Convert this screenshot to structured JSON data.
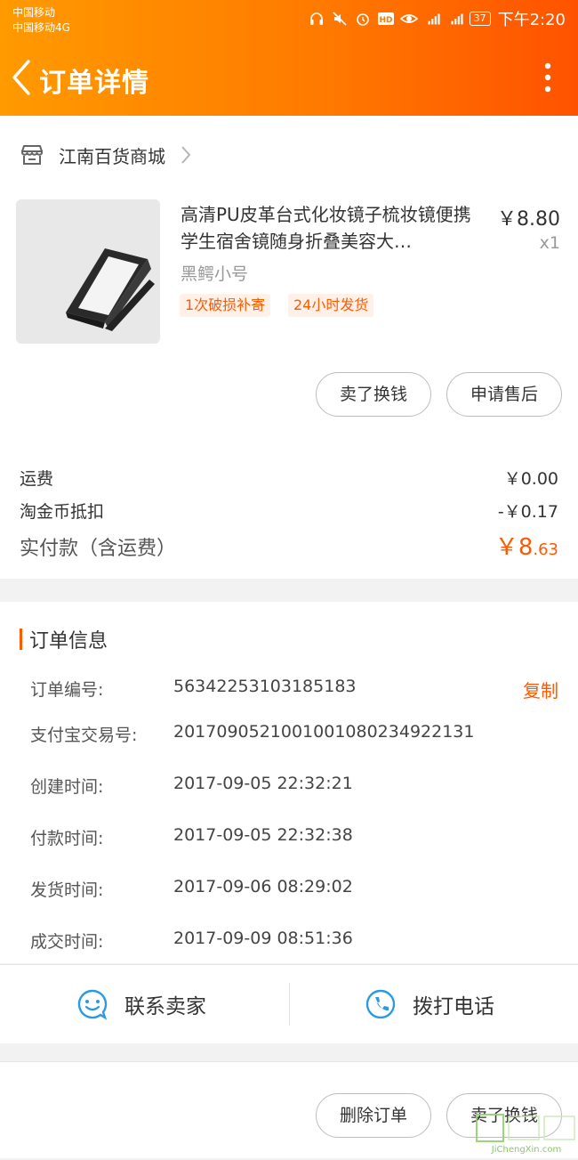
{
  "status_bar": {
    "carrier1": "中国移动",
    "carrier2": "中国移动4G",
    "battery": "37",
    "time": "下午2:20"
  },
  "header": {
    "title": "订单详情"
  },
  "shop": {
    "name": "江南百货商城"
  },
  "product": {
    "title": "高清PU皮革台式化妆镜子梳妆镜便携学生宿舍镜随身折叠美容大…",
    "price": "￥8.80",
    "quantity": "x1",
    "sku": "黑鳄小号",
    "tags": [
      "1次破损补寄",
      "24小时发货"
    ]
  },
  "actions": {
    "sell_label": "卖了换钱",
    "after_sale_label": "申请售后"
  },
  "fees": {
    "shipping_label": "运费",
    "shipping_value": "￥0.00",
    "coin_label": "淘金币抵扣",
    "coin_value": "-￥0.17",
    "total_label": "实付款（含运费）",
    "total_currency": "￥",
    "total_int": "8",
    "total_dec": ".63"
  },
  "order_info": {
    "heading": "订单信息",
    "copy_label": "复制",
    "rows": [
      {
        "k": "订单编号:",
        "v": "56342253103185183"
      },
      {
        "k": "支付宝交易号:",
        "v": "2017090521001001080234922131"
      },
      {
        "k": "创建时间:",
        "v": "2017-09-05 22:32:21"
      },
      {
        "k": "付款时间:",
        "v": "2017-09-05 22:32:38"
      },
      {
        "k": "发货时间:",
        "v": "2017-09-06 08:29:02"
      },
      {
        "k": "成交时间:",
        "v": "2017-09-09 08:51:36"
      }
    ]
  },
  "contact": {
    "seller_label": "联系卖家",
    "call_label": "拨打电话"
  },
  "bottom": {
    "delete_label": "删除订单",
    "sell_label": "卖了换钱"
  },
  "watermark": {
    "text": "JiChengXin.com"
  },
  "colors": {
    "accent": "#ff5a00",
    "header_start": "#ff9a00",
    "header_end": "#ff5200"
  }
}
